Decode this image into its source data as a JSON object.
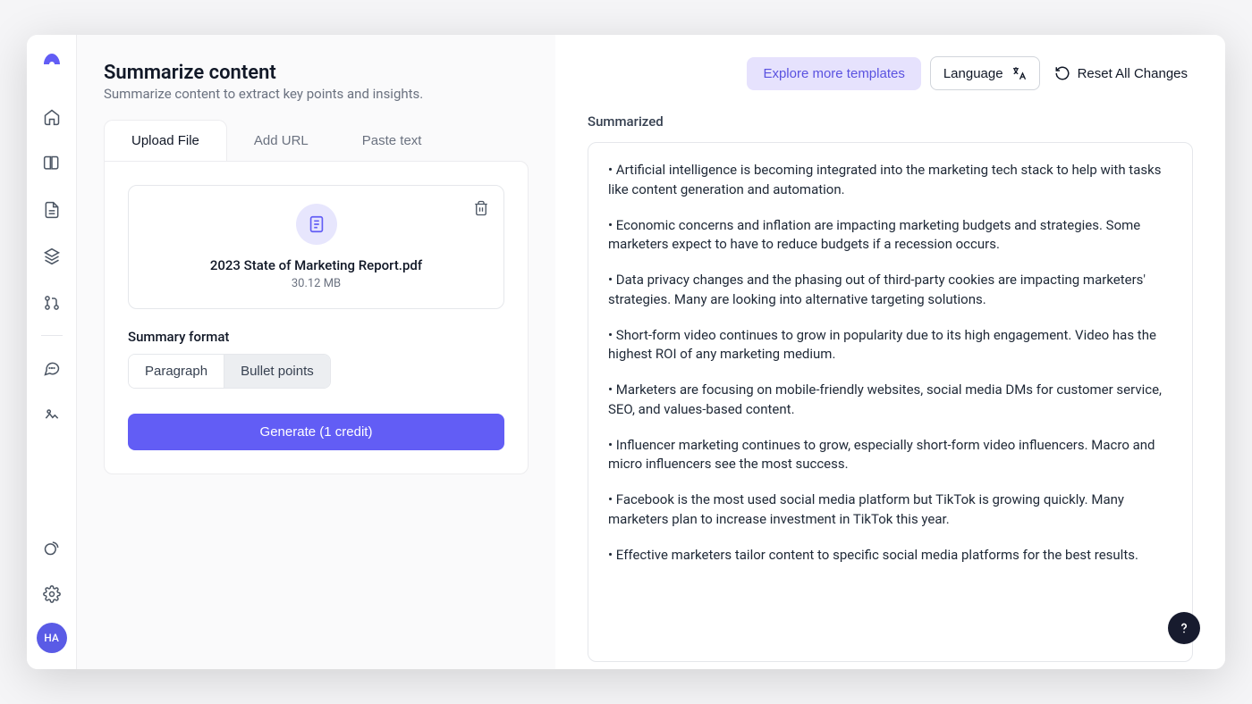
{
  "sidebar": {
    "avatar_initials": "HA"
  },
  "page": {
    "title": "Summarize content",
    "subtitle": "Summarize content to extract key points and insights."
  },
  "tabs": [
    {
      "label": "Upload File",
      "active": true
    },
    {
      "label": "Add URL",
      "active": false
    },
    {
      "label": "Paste text",
      "active": false
    }
  ],
  "file": {
    "name": "2023 State of Marketing Report.pdf",
    "size": "30.12 MB"
  },
  "format": {
    "label": "Summary format",
    "options": [
      "Paragraph",
      "Bullet points"
    ],
    "selected": "Bullet points"
  },
  "generate_label": "Generate (1 credit)",
  "topbar": {
    "explore": "Explore more templates",
    "language": "Language",
    "reset": "Reset All Changes"
  },
  "output": {
    "title": "Summarized",
    "bullets": [
      "Artificial intelligence is becoming integrated into the marketing tech stack to help with tasks like content generation and automation.",
      "Economic concerns and inflation are impacting marketing budgets and strategies. Some marketers expect to have to reduce budgets if a recession occurs.",
      "Data privacy changes and the phasing out of third-party cookies are impacting marketers' strategies. Many are looking into alternative targeting solutions.",
      "Short-form video continues to grow in popularity due to its high engagement. Video has the highest ROI of any marketing medium.",
      "Marketers are focusing on mobile-friendly websites, social media DMs for customer service, SEO, and values-based content.",
      "Influencer marketing continues to grow, especially short-form video influencers. Macro and micro influencers see the most success.",
      "Facebook is the most used social media platform but TikTok is growing quickly. Many marketers plan to increase investment in TikTok this year.",
      "Effective marketers tailor content to specific social media platforms for the best results."
    ]
  },
  "colors": {
    "accent": "#625df5",
    "accent_light": "#e6e2fd"
  }
}
